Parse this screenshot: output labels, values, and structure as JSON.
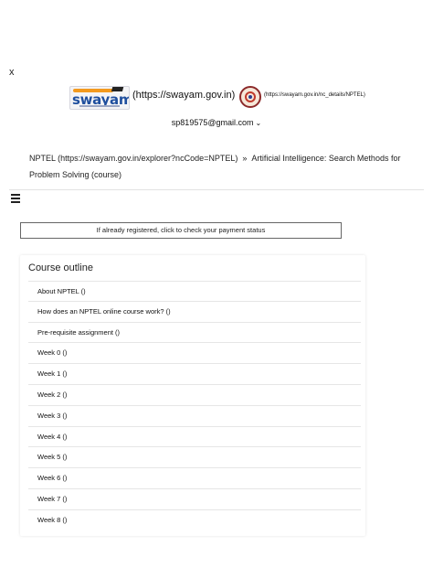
{
  "header": {
    "close_label": "x",
    "swayam_logo_text": "swayam",
    "swayam_link": "(https://swayam.gov.in)",
    "nptel_link": "(https://swayam.gov.in/nc_details/NPTEL)",
    "user_email": "sp819575@gmail.com",
    "user_chevron": "⌄"
  },
  "breadcrumb": {
    "root": "NPTEL (https://swayam.gov.in/explorer?ncCode=NPTEL)",
    "separator": "»",
    "current": "Artificial Intelligence: Search Methods for Problem Solving (course)"
  },
  "payment": {
    "label": "If already registered, click to check your payment status"
  },
  "outline": {
    "title": "Course outline",
    "items": [
      "About NPTEL ()",
      "How does an NPTEL online course work? ()",
      "Pre-requisite assignment ()",
      "Week 0 ()",
      "Week 1 ()",
      "Week 2 ()",
      "Week 3 ()",
      "Week 4 ()",
      "Week 5 ()",
      "Week 6 ()",
      "Week 7 ()",
      "Week 8 ()"
    ]
  }
}
